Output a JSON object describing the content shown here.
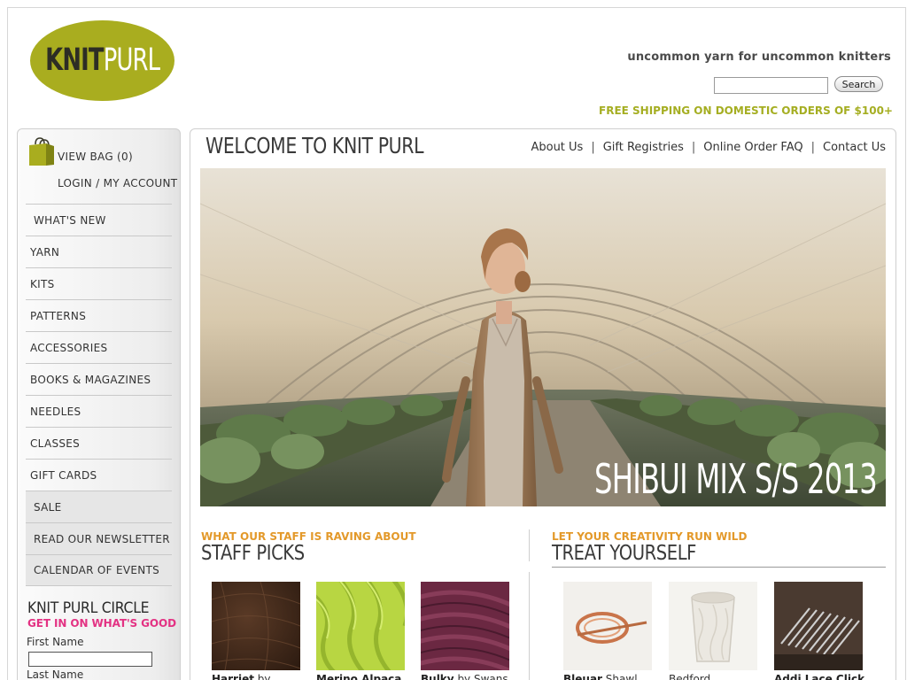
{
  "header": {
    "logo_knit": "KNIT",
    "logo_purl": "PURL",
    "tagline": "uncommon yarn for uncommon knitters",
    "search_button": "Search",
    "search_value": "",
    "shipping": "FREE SHIPPING ON DOMESTIC ORDERS OF $100+"
  },
  "sidebar": {
    "view_bag": "VIEW BAG (0)",
    "login": "LOGIN / MY ACCOUNT",
    "items": [
      {
        "label": "WHAT'S NEW"
      },
      {
        "label": "YARN"
      },
      {
        "label": "KITS"
      },
      {
        "label": "PATTERNS"
      },
      {
        "label": "ACCESSORIES"
      },
      {
        "label": "BOOKS & MAGAZINES"
      },
      {
        "label": "NEEDLES"
      },
      {
        "label": "CLASSES"
      },
      {
        "label": "GIFT CARDS"
      },
      {
        "label": "SALE"
      },
      {
        "label": "READ OUR NEWSLETTER"
      },
      {
        "label": "CALENDAR OF EVENTS"
      }
    ],
    "circle_title": "KNIT PURL CIRCLE",
    "circle_subtitle": "GET IN ON WHAT'S GOOD",
    "first_name_label": "First Name",
    "first_name_value": "",
    "last_name_label": "Last Name"
  },
  "main": {
    "welcome": "WELCOME TO KNIT PURL",
    "topnav": [
      "About Us",
      "Gift Registries",
      "Online Order FAQ",
      "Contact Us"
    ],
    "hero_caption": "SHIBUI MIX S/S 2013",
    "staff": {
      "kicker": "WHAT OUR STAFF IS RAVING ABOUT",
      "title": "STAFF PICKS",
      "products": [
        {
          "name": "Harriet",
          "by": "by"
        },
        {
          "name": "Merino Alpaca",
          "by": ""
        },
        {
          "name": "Bulky",
          "by": "by Swans"
        }
      ]
    },
    "treat": {
      "kicker": "LET YOUR CREATIVITY RUN WILD",
      "title": "TREAT YOURSELF",
      "products": [
        {
          "name": "Bleuar",
          "by": "Shawl"
        },
        {
          "name": "",
          "by": "Bedford"
        },
        {
          "name": "Addi Lace Click",
          "by": ""
        }
      ]
    }
  },
  "colors": {
    "brand_olive": "#a9ad1f",
    "shipping_text": "#a5ae22",
    "kicker_orange": "#e3992a",
    "signup_pink": "#e33283"
  }
}
